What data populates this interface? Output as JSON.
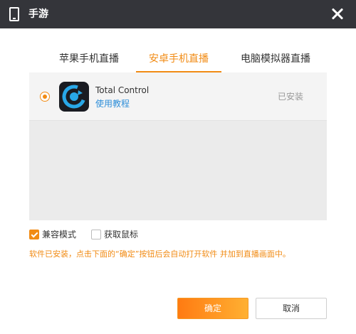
{
  "window": {
    "title": "手游",
    "phone_icon": "phone-icon",
    "close_icon": "close-icon"
  },
  "tabs": [
    {
      "label": "苹果手机直播",
      "active": false
    },
    {
      "label": "安卓手机直播",
      "active": true
    },
    {
      "label": "电脑模拟器直播",
      "active": false
    }
  ],
  "app": {
    "name": "Total Control",
    "tutorial_link": "使用教程",
    "status": "已安装",
    "icon": "total-control-app-icon",
    "selected": true
  },
  "options": {
    "compat_mode": {
      "label": "兼容模式",
      "checked": true
    },
    "capture_mouse": {
      "label": "获取鼠标",
      "checked": false
    }
  },
  "notice": "软件已安装，点击下面的“确定”按钮后会自动打开软件 并加到直播画面中。",
  "buttons": {
    "ok": "确定",
    "cancel": "取消"
  },
  "colors": {
    "accent": "#f18b14",
    "titlebar": "#34353a",
    "link": "#2d8ed9"
  }
}
